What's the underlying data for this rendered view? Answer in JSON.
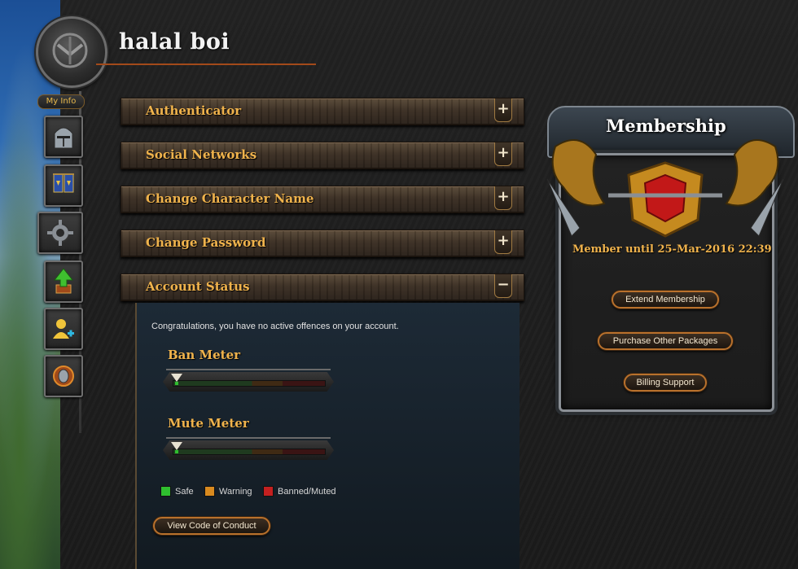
{
  "header": {
    "player_name": "halal boi"
  },
  "nav": {
    "my_info_label": "My Info",
    "items": [
      {
        "icon": "knight-helmet-icon"
      },
      {
        "icon": "banners-icon"
      },
      {
        "icon": "gear-icon"
      },
      {
        "icon": "upgrade-arrow-icon"
      },
      {
        "icon": "add-friend-icon"
      },
      {
        "icon": "shield-crest-icon"
      }
    ]
  },
  "sections": [
    {
      "label": "Authenticator",
      "toggle": "+"
    },
    {
      "label": "Social Networks",
      "toggle": "+"
    },
    {
      "label": "Change Character Name",
      "toggle": "+"
    },
    {
      "label": "Change Password",
      "toggle": "+"
    },
    {
      "label": "Account Status",
      "toggle": "−"
    }
  ],
  "account_status": {
    "message": "Congratulations, you have no active offences on your account.",
    "ban_meter_title": "Ban Meter",
    "mute_meter_title": "Mute Meter",
    "ban_level": 0,
    "mute_level": 0,
    "legend": [
      {
        "label": "Safe",
        "color": "#2fbf2f"
      },
      {
        "label": "Warning",
        "color": "#d98a1f"
      },
      {
        "label": "Banned/Muted",
        "color": "#c42020"
      }
    ],
    "code_of_conduct_button": "View Code of Conduct"
  },
  "membership": {
    "title": "Membership",
    "until_text": "Member until 25-Mar-2016 22:39",
    "buttons": [
      "Extend Membership",
      "Purchase Other Packages",
      "Billing Support"
    ]
  },
  "colors": {
    "accent_gold": "#f0b34c",
    "button_border": "#b9712c"
  }
}
